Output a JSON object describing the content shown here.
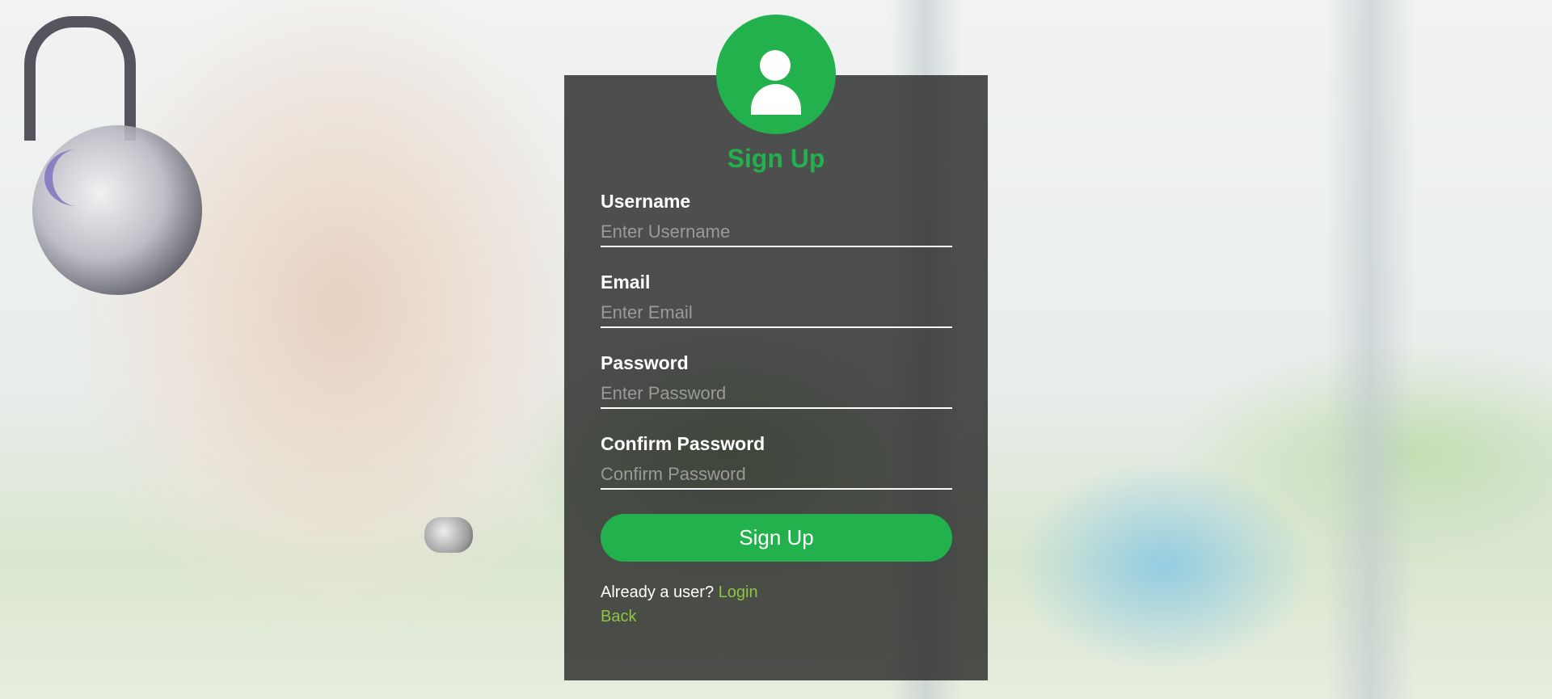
{
  "form": {
    "title": "Sign Up",
    "fields": [
      {
        "label": "Username",
        "placeholder": "Enter Username",
        "value": ""
      },
      {
        "label": "Email",
        "placeholder": "Enter Email",
        "value": ""
      },
      {
        "label": "Password",
        "placeholder": "Enter Password",
        "value": ""
      },
      {
        "label": "Confirm Password",
        "placeholder": "Confirm Password",
        "value": ""
      }
    ],
    "submit_label": "Sign Up",
    "login_prompt": "Already a user?",
    "login_link": "Login",
    "back_link": "Back"
  },
  "icons": {
    "avatar": "user-icon"
  },
  "colors": {
    "accent": "#22b14c",
    "link": "#8dc63f",
    "panel": "#1a1a1a",
    "text": "#ffffff",
    "placeholder": "#9a9a9a"
  }
}
